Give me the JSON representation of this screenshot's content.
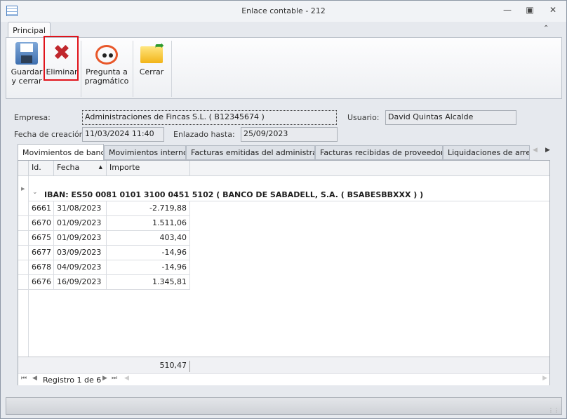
{
  "window": {
    "title": "Enlace contable - 212"
  },
  "ribbon": {
    "tab": "Principal",
    "buttons": [
      {
        "id": "save",
        "label1": "Guardar",
        "label2": "y cerrar",
        "icon": "floppy-disk-icon"
      },
      {
        "id": "delete",
        "label1": "Eliminar",
        "label2": "",
        "icon": "red-x-icon"
      },
      {
        "id": "ask",
        "label1": "Pregunta a",
        "label2": "pragmático",
        "icon": "robot-face-icon"
      },
      {
        "id": "close",
        "label1": "Cerrar",
        "label2": "",
        "icon": "folder-arrow-icon"
      }
    ]
  },
  "form": {
    "empresa_label": "Empresa:",
    "empresa": "Administraciones de Fincas S.L. ( B12345674 )",
    "usuario_label": "Usuario:",
    "usuario": "David Quintas Alcalde",
    "fecha_label": "Fecha de creación:",
    "fecha": "11/03/2024 11:40",
    "enlazado_label": "Enlazado hasta:",
    "enlazado": "25/09/2023"
  },
  "tabs": [
    "Movimientos de banco",
    "Movimientos internos",
    "Facturas emitidas del administrador",
    "Facturas recibidas de proveedores",
    "Liquidaciones de arrenda"
  ],
  "grid": {
    "columns": [
      "Id.",
      "Fecha",
      "Importe"
    ],
    "group": "IBAN: ES50 0081 0101 3100 0451 5102 ( BANCO DE SABADELL, S.A. ( BSABESBBXXX ) )",
    "rows": [
      {
        "id": "6661",
        "fecha": "31/08/2023",
        "importe": "-2.719,88"
      },
      {
        "id": "6670",
        "fecha": "01/09/2023",
        "importe": "1.511,06"
      },
      {
        "id": "6675",
        "fecha": "01/09/2023",
        "importe": "403,40"
      },
      {
        "id": "6677",
        "fecha": "03/09/2023",
        "importe": "-14,96"
      },
      {
        "id": "6678",
        "fecha": "04/09/2023",
        "importe": "-14,96"
      },
      {
        "id": "6676",
        "fecha": "16/09/2023",
        "importe": "1.345,81"
      }
    ],
    "total": "510,47",
    "navigator": "Registro 1 de 6"
  }
}
